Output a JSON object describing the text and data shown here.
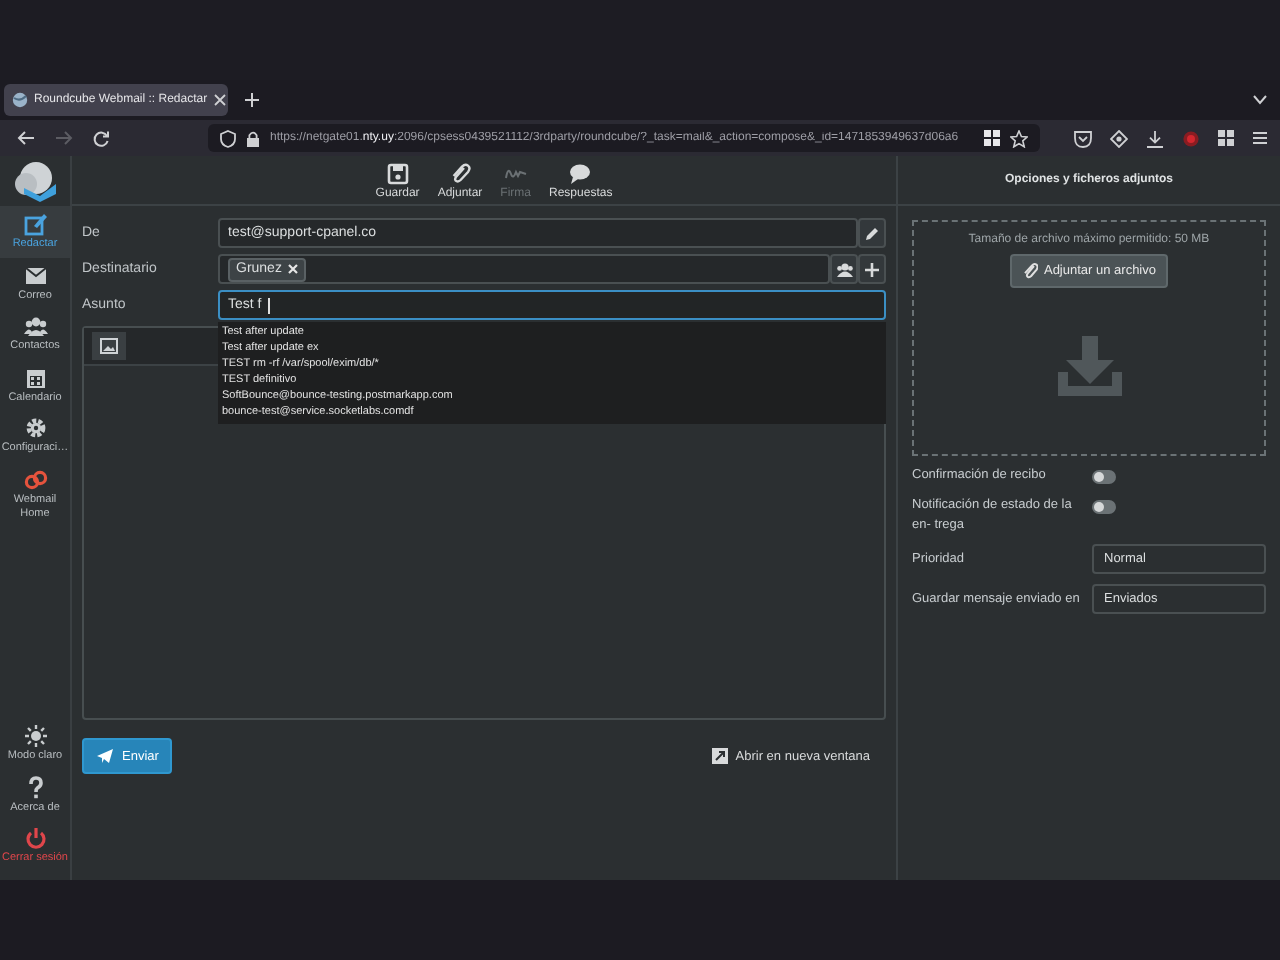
{
  "browser": {
    "tab": {
      "title": "Roundcube Webmail :: Redactar",
      "selected": true
    },
    "url": "https://netgate01.**nty.uy**:2096/cpsess0439521112/3rdparty/roundcube/?_task=mail&_action=compose&_id=1471853949637d06a6"
  },
  "sidebar": {
    "items": [
      {
        "label": "Redactar",
        "kind": "compose",
        "selected": true
      },
      {
        "label": "Correo",
        "kind": "mail",
        "selected": false
      },
      {
        "label": "Contactos",
        "kind": "contacts",
        "selected": false
      },
      {
        "label": "Calendario",
        "kind": "calendar",
        "selected": false
      },
      {
        "label": "Configuraci…",
        "kind": "settings",
        "selected": false
      },
      {
        "label": "Webmail Home",
        "kind": "home",
        "selected": false
      }
    ],
    "bottom_items": [
      {
        "label": "Modo claro",
        "kind": "theme"
      },
      {
        "label": "Acerca de",
        "kind": "about"
      },
      {
        "label": "Cerrar sesión",
        "kind": "logout"
      }
    ]
  },
  "toolbar": [
    {
      "label": "Guardar",
      "kind": "save",
      "disabled": false
    },
    {
      "label": "Adjuntar",
      "kind": "attach",
      "disabled": false
    },
    {
      "label": "Firma",
      "kind": "signature",
      "disabled": true
    },
    {
      "label": "Respuestas",
      "kind": "responses",
      "disabled": false
    }
  ],
  "compose": {
    "fields": [
      {
        "label": "De",
        "kind": "text",
        "value": "test@support-cpanel.co",
        "focused": false
      },
      {
        "label": "Destinatario",
        "kind": "recipients",
        "chips": [
          "Grunez"
        ],
        "focused": false
      },
      {
        "label": "Asunto",
        "kind": "text",
        "value": "Test f",
        "focused": true
      }
    ],
    "suggestions": [
      "Test after update",
      "Test after update ex",
      "TEST rm -rf /var/spool/exim/db/*",
      "TEST definitivo",
      "SoftBounce@bounce-testing.postmarkapp.com",
      "bounce-test@service.socketlabs.comdf"
    ],
    "send_button": "Enviar",
    "new_window": "Abrir en nueva ventana"
  },
  "options": {
    "title": "Opciones y ficheros adjuntos",
    "upload": {
      "hint": "Tamaño de archivo máximo permitido: 50 MB",
      "button": "Adjuntar un archivo"
    },
    "toggles": [
      {
        "label": "Confirmación de recibo",
        "on": false
      },
      {
        "label": "Notificación de estado de la en- trega",
        "on": false
      }
    ],
    "selects": [
      {
        "label": "Prioridad",
        "value": "Normal"
      },
      {
        "label": "Guardar mensaje enviado en",
        "value": "Enviados"
      }
    ]
  }
}
